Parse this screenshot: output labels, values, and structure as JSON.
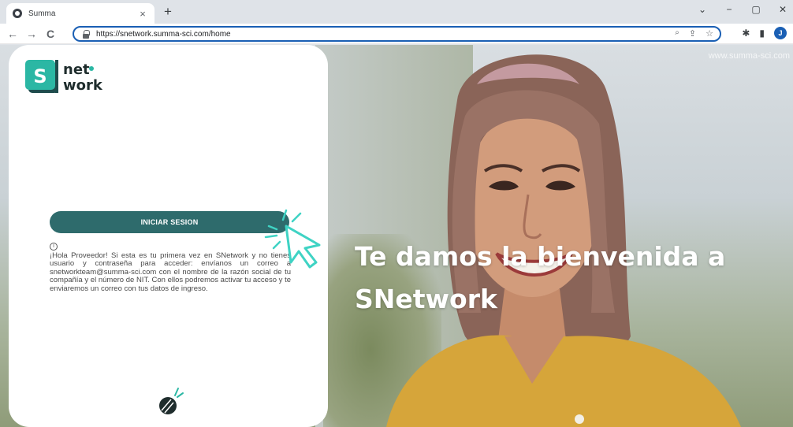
{
  "browser": {
    "tab_title": "Summa",
    "tab_close": "×",
    "new_tab": "+",
    "window_controls": [
      "⌄",
      "−",
      "▢",
      "✕"
    ],
    "back": "←",
    "forward": "→",
    "reload": "C",
    "url": "https://snetwork.summa-sci.com/home",
    "omnibox_icons": [
      "🔍",
      "⇪",
      "☆"
    ],
    "profile_initial": "J"
  },
  "page": {
    "watermark": "www.summa-sci.com",
    "logo": {
      "text_top": "net",
      "text_bottom": "work",
      "badge": "S",
      "accent_color": "#2bb7a4",
      "badge_color": "#2e6b6c"
    },
    "login_button": "INICIAR SESION",
    "info_icon": "i",
    "info_text": "¡Hola Proveedor! Si esta es tu primera vez en SNetwork y no tienes usuario y contraseña para acceder: envíanos un correo a snetworkteam@summa-sci.com con el nombre de la razón social de tu compañía y el número de NIT. Con ellos podremos activar tu acceso y te enviaremos un correo con tus datos de ingreso.",
    "welcome_line1": "Te damos la bienvenida a",
    "welcome_line2": "SNetwork"
  },
  "colors": {
    "primary": "#2e6b6c",
    "accent": "#2bb7a4",
    "cursor": "#3fd3c4"
  }
}
